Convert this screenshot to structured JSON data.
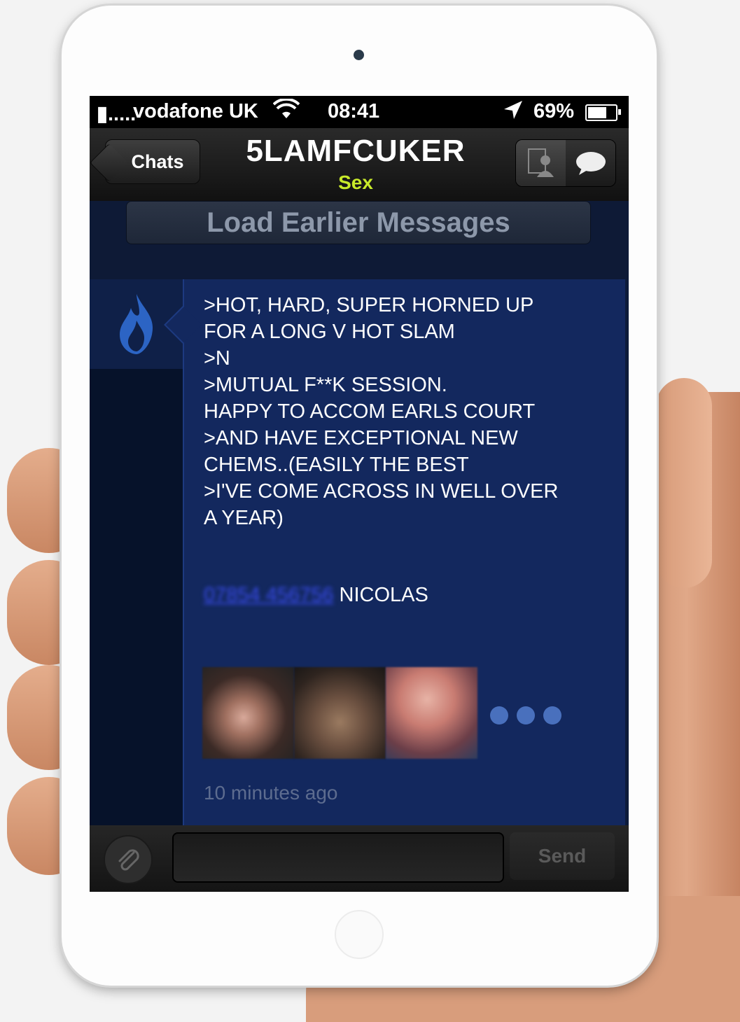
{
  "status_bar": {
    "signal": "▮.....",
    "carrier": "vodafone UK",
    "time": "08:41",
    "battery_percent": "69%"
  },
  "nav": {
    "back_label": "Chats",
    "title": "5LAMFCUKER",
    "subtitle": "Sex"
  },
  "load_earlier_label": "Load Earlier Messages",
  "message": {
    "lines": [
      ">HOT, HARD, SUPER HORNED UP",
      "FOR A LONG V HOT SLAM",
      ">N",
      ">MUTUAL F**K SESSION.",
      "HAPPY TO ACCOM EARLS COURT",
      ">AND HAVE EXCEPTIONAL NEW",
      "CHEMS..(EASILY THE BEST",
      ">I'VE COME ACROSS IN WELL OVER",
      "A YEAR)"
    ],
    "contact_number": "07854 456756",
    "contact_name": "NICOLAS",
    "timestamp": "10 minutes ago"
  },
  "composer": {
    "send_label": "Send"
  },
  "icons": {
    "avatar": "flame-icon",
    "attach": "paperclip-icon",
    "profile_tab": "profile-icon",
    "chat_tab": "chat-bubble-icon",
    "more": "more-dots-icon"
  },
  "colors": {
    "background": "#0d1b3a",
    "bubble": "#13285e",
    "subtitle": "#c8ea2a",
    "link": "#3a4cf0"
  }
}
